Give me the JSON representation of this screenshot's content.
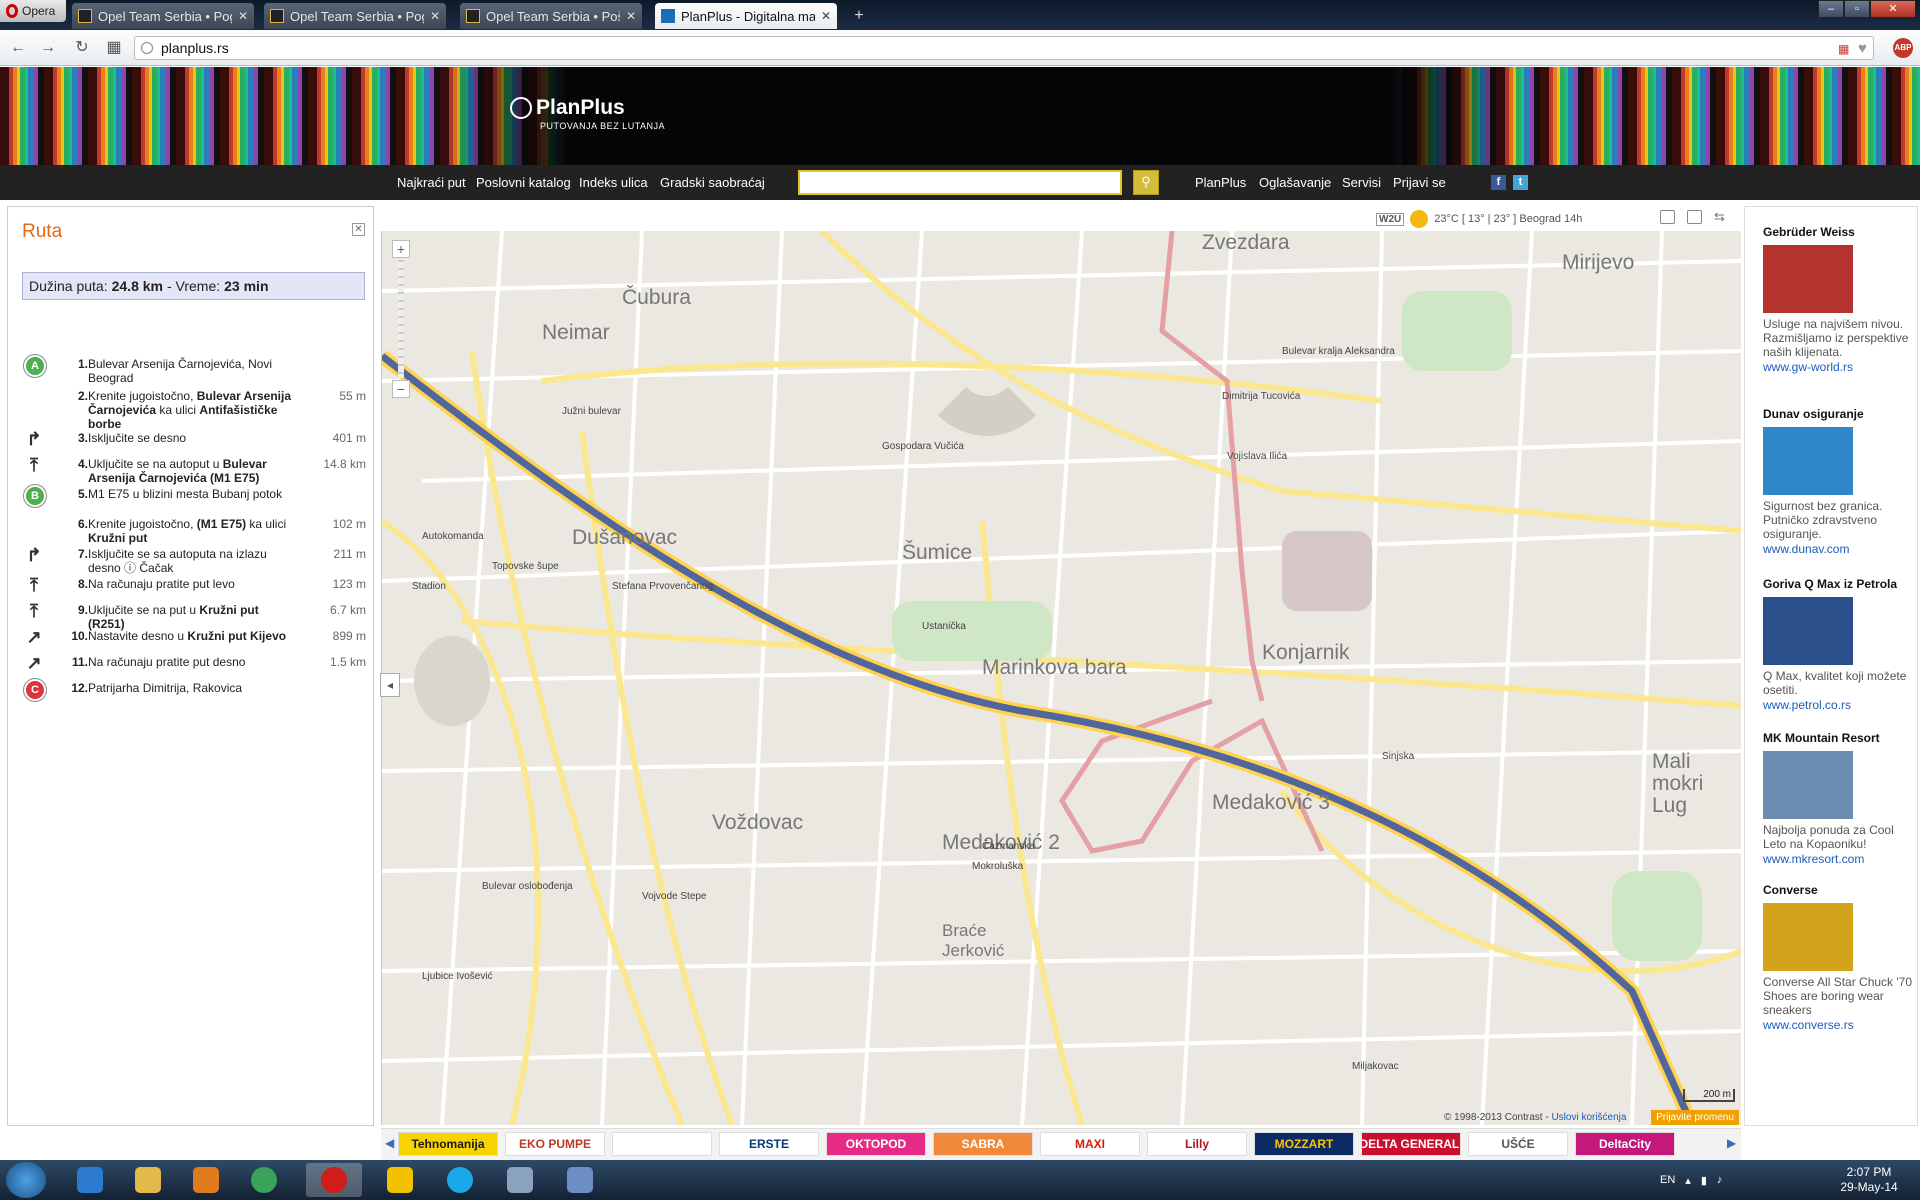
{
  "browser": {
    "menu_label": "Opera",
    "tabs": [
      {
        "title": "Opel Team Serbia • Pogledaj"
      },
      {
        "title": "Opel Team Serbia • Pogledaj"
      },
      {
        "title": "Opel Team Serbia • Pošalji"
      },
      {
        "title": "PlanPlus - Digitalna mapa"
      }
    ],
    "url": "planplus.rs",
    "adblock_label": "ABP"
  },
  "site": {
    "logo_name": "PlanPlus",
    "logo_tagline": "PUTOVANJA BEZ LUTANJA",
    "nav_left": [
      "Najkraći put",
      "Poslovni katalog",
      "Indeks ulica",
      "Gradski saobraćaj"
    ],
    "nav_right": [
      "PlanPlus",
      "Oglašavanje",
      "Servisi",
      "Prijavi se"
    ],
    "search_placeholder": ""
  },
  "route": {
    "title": "Ruta",
    "summary_length_label": "Dužina puta:",
    "summary_length": "24.8 km",
    "summary_sep": "- Vreme:",
    "summary_time": "23 min",
    "steps": [
      {
        "num": "1.",
        "html": "Bulevar Arsenija Čarnojevića, Novi Beograd",
        "dist": "",
        "icon": "pin-a"
      },
      {
        "num": "2.",
        "html": "Krenite jugoistočno, <b>Bulevar Arsenija Čarnojevića</b> ka ulici <b>Antifašističke borbe</b>",
        "dist": "55 m",
        "icon": ""
      },
      {
        "num": "3.",
        "html": "Isključite se desno",
        "dist": "401 m",
        "icon": "exit-right-arrow"
      },
      {
        "num": "4.",
        "html": "Uključite se na autoput u <b>Bulevar Arsenija Čarnojevića (M1 E75)</b>",
        "dist": "14.8 km",
        "icon": "merge-arrow"
      },
      {
        "num": "5.",
        "html": "M1 E75 u blizini mesta Bubanj potok",
        "dist": "",
        "icon": "pin-b"
      },
      {
        "num": "6.",
        "html": "Krenite jugoistočno, <b>(M1 E75)</b> ka ulici <b>Kružni put</b>",
        "dist": "102 m",
        "icon": ""
      },
      {
        "num": "7.",
        "html": "Isključite se sa autoputa na izlazu desno ⓘ Čačak",
        "dist": "211 m",
        "icon": "exit-right-arrow"
      },
      {
        "num": "8.",
        "html": "Na računaju pratite put levo",
        "dist": "123 m",
        "icon": "merge-arrow"
      },
      {
        "num": "9.",
        "html": "Uključite se na put u <b>Kružni put (R251)</b>",
        "dist": "6.7 km",
        "icon": "merge-arrow"
      },
      {
        "num": "10.",
        "html": "Nastavite desno u <b>Kružni put Kijevo</b>",
        "dist": "899 m",
        "icon": "slight-right-arrow"
      },
      {
        "num": "11.",
        "html": "Na računaju pratite put desno",
        "dist": "1.5 km",
        "icon": "slight-right-arrow"
      },
      {
        "num": "12.",
        "html": "Patrijarha Dimitrija, Rakovica",
        "dist": "",
        "icon": "pin-c"
      }
    ]
  },
  "map": {
    "weather_brand": "W2U",
    "weather_text": "23°C [ 13° | 23° ] Beograd 14h",
    "districts": [
      "Zvezdara",
      "Čubura",
      "Neimar",
      "Dušanovac",
      "Šumice",
      "Konjarnik",
      "Marinkova bara",
      "Voždovac",
      "Medaković 3",
      "Medaković 2",
      "Mirijevo",
      "Mali mokri Lug",
      "Braće Jerković"
    ],
    "streets": [
      "Bulevar kralja Aleksandra",
      "Južni bulevar",
      "Gospodara Vučića",
      "Ustanička",
      "Stefana Prvovenčanog",
      "Vojislava Ilića",
      "Mokroluška",
      "Čazmanska",
      "Dimitrija Tucovića",
      "Sinjska",
      "Vojvode Stepe",
      "Bulevar oslobođenja",
      "Miljakovac",
      "Ljubice Ivošević",
      "Autokomanda",
      "Stadion",
      "Topovske šupe"
    ],
    "scale_label": "200 m",
    "attribution": "© 1998-2013 Contrast -",
    "attribution_link": "Uslovi korišćenja",
    "report_label": "Prijavite promenu"
  },
  "ads": [
    {
      "title": "Gebrüder Weiss",
      "desc": "Usluge na najvišem nivou. Razmišljamo iz perspektive naših klijenata.",
      "url": "www.gw-world.rs",
      "color": "#b5332e"
    },
    {
      "title": "Dunav osiguranje",
      "desc": "Sigurnost bez granica. Putničko zdravstveno osiguranje.",
      "url": "www.dunav.com",
      "color": "#2f86c8"
    },
    {
      "title": "Goriva Q Max iz Petrola",
      "desc": "Q Max, kvalitet koji možete osetiti.",
      "url": "www.petrol.co.rs",
      "color": "#2a4f8a"
    },
    {
      "title": "MK Mountain Resort",
      "desc": "Najbolja ponuda za Cool Leto na Kopaoniku!",
      "url": "www.mkresort.com",
      "color": "#6b8bb0"
    },
    {
      "title": "Converse",
      "desc": "Converse All Star Chuck '70 Shoes are boring wear sneakers",
      "url": "www.converse.rs",
      "color": "#d4a31c"
    }
  ],
  "sponsors": [
    {
      "name": "Tehnomanija",
      "bg": "#f7d400",
      "fg": "#1a1a1a"
    },
    {
      "name": "EKO PUMPE",
      "bg": "#ffffff",
      "fg": "#c0392b"
    },
    {
      "name": "",
      "bg": "#ffffff",
      "fg": "#333"
    },
    {
      "name": "ERSTE",
      "bg": "#ffffff",
      "fg": "#003b7c"
    },
    {
      "name": "OKTOPOD",
      "bg": "#e52b86",
      "fg": "#ffffff"
    },
    {
      "name": "SABRA",
      "bg": "#f08a3a",
      "fg": "#ffffff"
    },
    {
      "name": "MAXI",
      "bg": "#ffffff",
      "fg": "#d81e05"
    },
    {
      "name": "Lilly",
      "bg": "#ffffff",
      "fg": "#b5121b"
    },
    {
      "name": "MOZZART",
      "bg": "#0c2a63",
      "fg": "#f7c600"
    },
    {
      "name": "DELTA GENERALI",
      "bg": "#c8102e",
      "fg": "#ffffff"
    },
    {
      "name": "UŠĆE",
      "bg": "#ffffff",
      "fg": "#555"
    },
    {
      "name": "DeltaCity",
      "bg": "#c4187d",
      "fg": "#ffffff"
    }
  ],
  "taskbar": {
    "lang": "EN",
    "time": "2:07 PM",
    "date": "29-May-14"
  }
}
